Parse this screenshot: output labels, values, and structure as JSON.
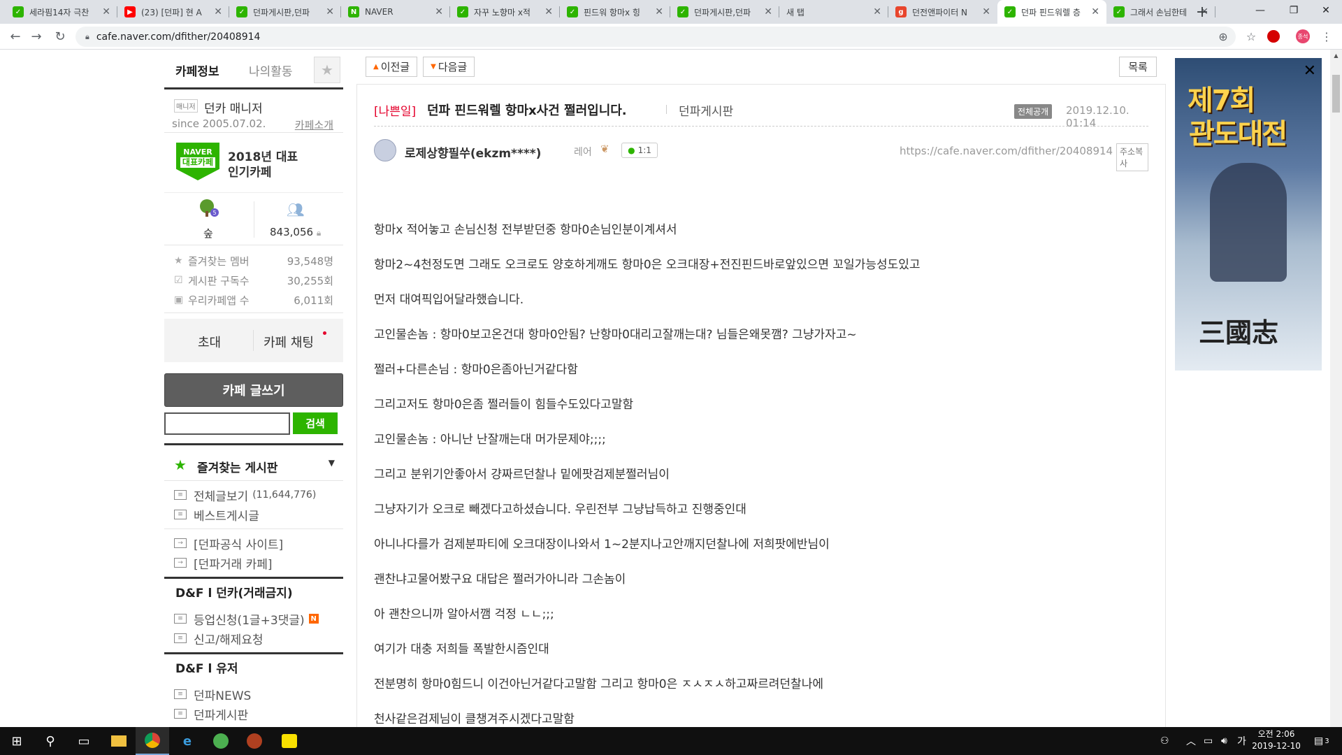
{
  "browser": {
    "tabs": [
      {
        "title": "세라핌14자 극찬",
        "color": "#2db400",
        "glyph": "✓"
      },
      {
        "title": "(23) [던파] 현 A",
        "color": "#ff0000",
        "glyph": "▶"
      },
      {
        "title": "던파게시판,던파",
        "color": "#2db400",
        "glyph": "✓"
      },
      {
        "title": "NAVER",
        "color": "#2db400",
        "glyph": "N"
      },
      {
        "title": "자꾸 노향마 x적",
        "color": "#2db400",
        "glyph": "✓"
      },
      {
        "title": "핀드워 항마x 힝",
        "color": "#2db400",
        "glyph": "✓"
      },
      {
        "title": "던파게시판,던파",
        "color": "#2db400",
        "glyph": "✓"
      },
      {
        "title": "새 탭",
        "color": "",
        "glyph": ""
      },
      {
        "title": "던전앤파이터 N",
        "color": "#e8452c",
        "glyph": "g"
      },
      {
        "title": "던파 핀드워렐 층",
        "color": "#2db400",
        "glyph": "✓"
      },
      {
        "title": "그래서 손님한테",
        "color": "#2db400",
        "glyph": "✓"
      }
    ],
    "active_tab": 9,
    "url": "cafe.naver.com/dfither/20408914",
    "profile_label": "종석"
  },
  "sidebar": {
    "tab_info": "카페정보",
    "tab_activity": "나의활동",
    "manager_badge": "매니저",
    "manager_name": "던카 매니저",
    "since": "since 2005.07.02.",
    "intro_link": "카페소개",
    "award_logo_top": "NAVER",
    "award_logo_bottom": "대표카페",
    "award_line1": "2018년 대표",
    "award_line2": "인기카페",
    "level_badge": "5",
    "level_label": "숲",
    "member_count": "843,056",
    "info": [
      {
        "icon": "★",
        "label": "즐겨찾는 멤버",
        "value": "93,548명"
      },
      {
        "icon": "☑",
        "label": "게시판 구독수",
        "value": "30,255회"
      },
      {
        "icon": "▣",
        "label": "우리카페앱 수",
        "value": "6,011회"
      }
    ],
    "invite": "초대",
    "chat": "카페 채팅",
    "write": "카페 글쓰기",
    "search_btn": "검색",
    "search_value": "",
    "fav_title": "즐겨찾는 게시판",
    "menu1": [
      {
        "label": "전체글보기",
        "count": "(11,644,776)"
      },
      {
        "label": "베스트게시글",
        "count": ""
      }
    ],
    "menu2": [
      {
        "label": "[던파공식 사이트]"
      },
      {
        "label": "[던파거래 카페]"
      }
    ],
    "group1": "D&F l 던카(거래금지)",
    "menu3": [
      {
        "label": "등업신청(1글+3댓글)",
        "badge": "N"
      },
      {
        "label": "신고/해제요청",
        "badge": ""
      }
    ],
    "group2": "D&F l 유저",
    "menu4": [
      {
        "label": "던파NEWS"
      },
      {
        "label": "던파게시판"
      }
    ]
  },
  "article": {
    "prev": "이전글",
    "next": "다음글",
    "list": "목록",
    "category": "[나쁜일]",
    "title": "던파 핀드워렐 항마x사건 쩔러입니다.",
    "board": "던파게시판",
    "visibility": "전체공개",
    "date": "2019.12.10. 01:14",
    "author": "로제상향필쑤(ekzm****)",
    "level": "레어",
    "chat": "1:1",
    "url": "https://cafe.naver.com/dfither/20408914",
    "copy": "주소복사",
    "lines": [
      "항마x 적어놓고 손님신청 전부받던중 항마0손님인분이계셔서",
      "항마2~4천정도면 그래도 오크로도 양호하게깨도 항마0은 오크대장+전진핀드바로앞있으면 꼬일가능성도있고",
      "먼저 대여픽입어달라했습니다.",
      "고인물손놈 : 항마0보고온건대 항마0안됨? 난항마0대리고잘깨는대? 님들은왜못깸? 그냥가자고~",
      "쩔러+다른손님 : 항마0은좀아닌거같다함",
      "그리고저도 항마0은좀 쩔러들이 힘들수도있다고말함",
      "고인물손놈 : 아니난 난잘깨는대 머가문제야;;;;",
      "그리고 분위기안좋아서 걍짜르던찰나 밑에팟검제분쩔러님이",
      "그냥자기가 오크로 빼겠다고하셨습니다. 우린전부 그냥납득하고 진행중인대",
      "아니나다를가 검제분파티에 오크대장이나와서 1~2분지나고안깨지던찰나에 저희팟에반님이",
      "괜찬냐고물어봤구요 대답은 쩔러가아니라 그손놈이",
      "아 괜찬으니까 알아서깸 걱정 ㄴㄴ;;;",
      "여기가 대충 저희들 폭발한시즘인대",
      "전분명히 항마0힘드니 이건아닌거같다고말함 그리고 항마0은 ㅈㅅㅈㅅ하고짜르려던찰나에",
      "천사같은검제님이 클챙겨주시겠다고말함"
    ]
  },
  "ad": {
    "headline1": "제7회",
    "headline2": "관도대전",
    "logo": "三國志"
  },
  "taskbar": {
    "time": "오전 2:06",
    "date": "2019-12-10",
    "notif": "3"
  }
}
